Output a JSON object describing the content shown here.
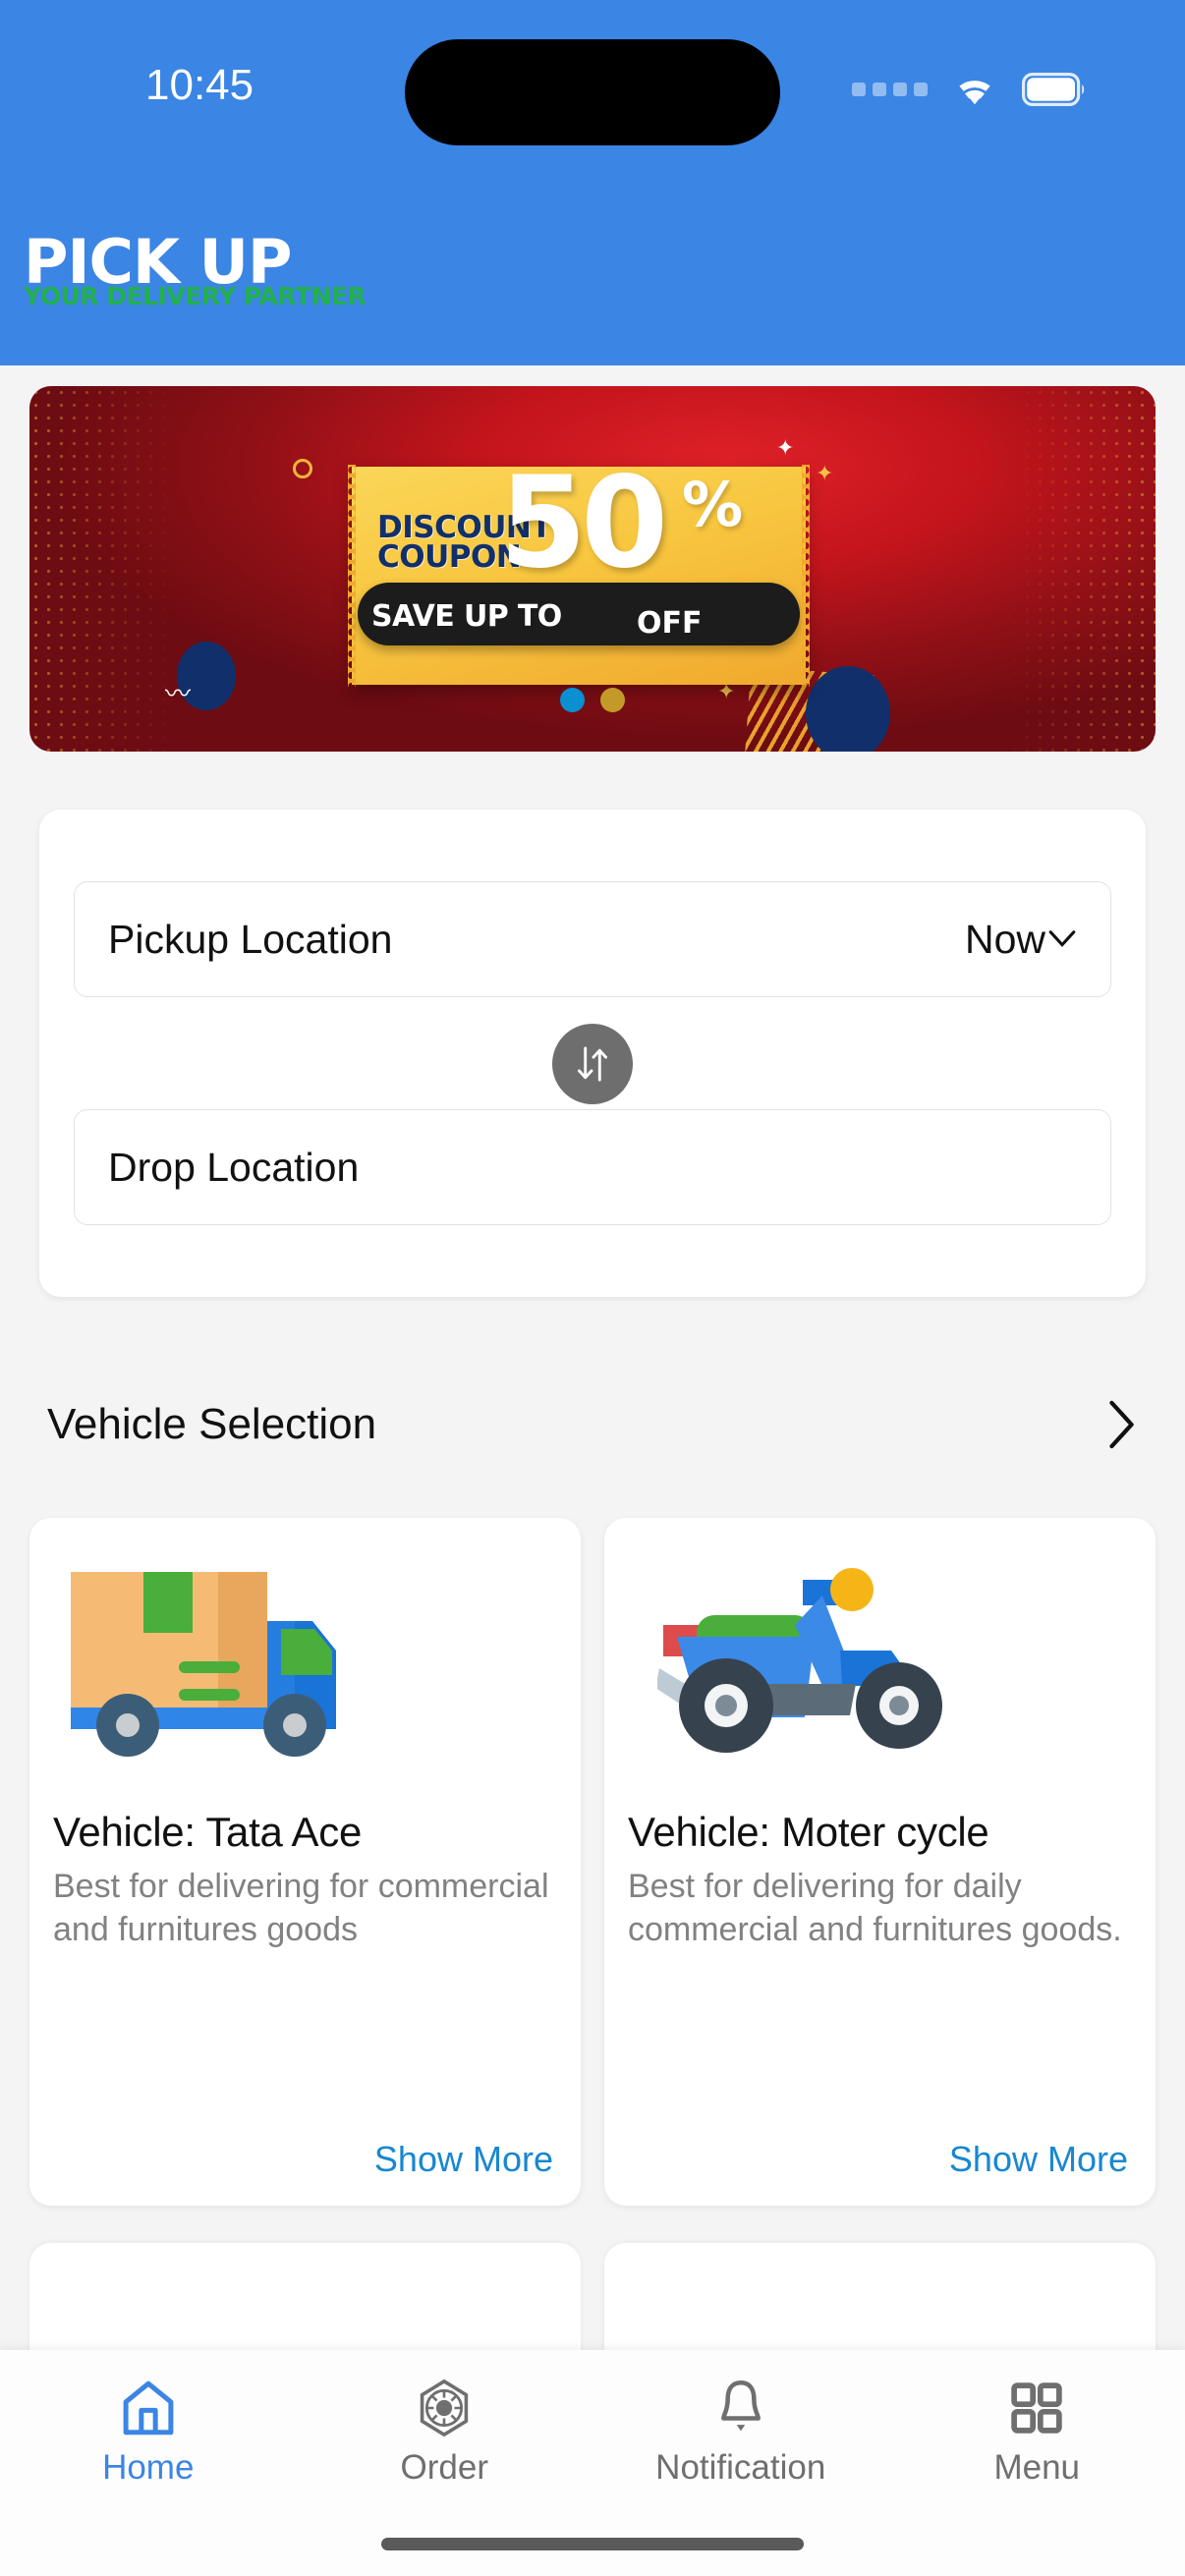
{
  "status_bar": {
    "time": "10:45",
    "icons": [
      "cellular-dots-icon",
      "wifi-icon",
      "battery-icon"
    ]
  },
  "header": {
    "logo_main": "PICK UP",
    "logo_tagline": "YOUR DELIVERY PARTNER",
    "background_color": "#3b85e4",
    "tagline_color": "#22b14c"
  },
  "promo_banner": {
    "label_discount": "DISCOUNT",
    "label_coupon": "COUPON",
    "label_save_up_to": "SAVE UP TO",
    "amount": "50",
    "percent": "%",
    "label_off": "OFF",
    "pager": [
      {
        "name": "active",
        "color": "#0a8fd1"
      },
      {
        "name": "inactive",
        "color": "#c39a2a"
      }
    ]
  },
  "location_card": {
    "pickup_label": "Pickup Location",
    "pickup_time_value": "Now",
    "drop_label": "Drop Location",
    "swap_icon": "swap-vertical-icon"
  },
  "vehicle_selection": {
    "title": "Vehicle Selection",
    "chevron_icon": "chevron-right-icon"
  },
  "vehicles": [
    {
      "art": "delivery-truck-illustration",
      "title": "Vehicle: Tata Ace",
      "description": "Best for delivering for commercial and furnitures goods",
      "show_more": "Show More"
    },
    {
      "art": "scooter-illustration",
      "title": "Vehicle: Moter cycle",
      "description": "Best for delivering for daily commercial and furnitures goods.",
      "show_more": "Show More"
    }
  ],
  "bottom_nav": {
    "active_color": "#3b85e4",
    "inactive_color": "#6f6f6f",
    "items": [
      {
        "label": "Home",
        "icon": "home-icon",
        "active": true
      },
      {
        "label": "Order",
        "icon": "order-icon",
        "active": false
      },
      {
        "label": "Notification",
        "icon": "bell-icon",
        "active": false
      },
      {
        "label": "Menu",
        "icon": "grid-menu-icon",
        "active": false
      }
    ]
  }
}
